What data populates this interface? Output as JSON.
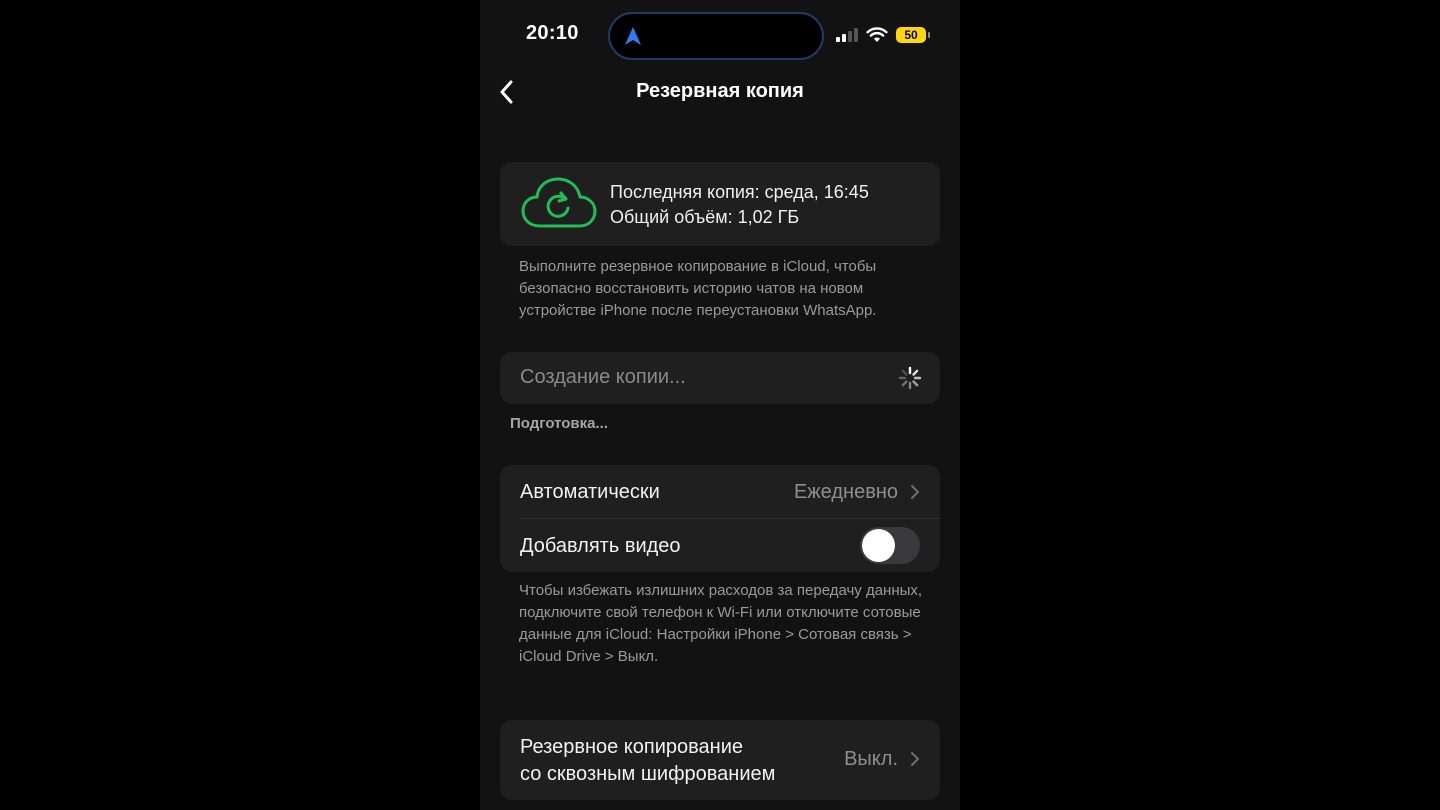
{
  "status_bar": {
    "time": "20:10",
    "battery": "50",
    "accent_nav": "#2f7df6",
    "battery_color": "#ffd60a"
  },
  "nav": {
    "title": "Резервная копия"
  },
  "backup_status": {
    "last_backup": "Последняя копия: среда, 16:45",
    "total_size": "Общий объём: 1,02 ГБ",
    "icon": "cloud-sync-icon",
    "icon_color": "#1fbf54"
  },
  "info_text": "Выполните резервное копирование в iCloud, чтобы безопасно восстановить историю чатов на новом устройстве iPhone после переустановки WhatsApp.",
  "progress": {
    "label": "Создание копии...",
    "status": "Подготовка..."
  },
  "settings": {
    "auto": {
      "label": "Автоматически",
      "value": "Ежедневно"
    },
    "video": {
      "label": "Добавлять видео",
      "enabled": false
    }
  },
  "cellular_note": "Чтобы избежать излишних расходов за передачу данных, подключите свой телефон к Wi-Fi или отключите сотовые данные для iCloud: Настройки iPhone > Сотовая связь > iCloud Drive > Выкл.",
  "e2e": {
    "label_line1": "Резервное копирование",
    "label_line2": "со сквозным шифрованием",
    "value": "Выкл."
  }
}
